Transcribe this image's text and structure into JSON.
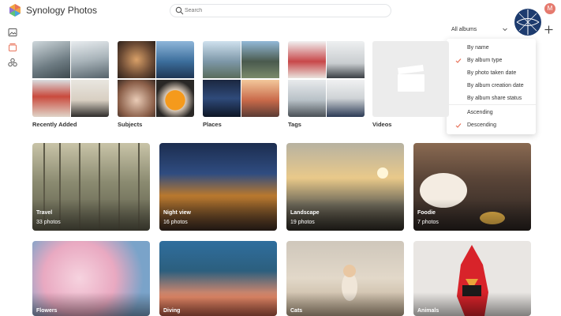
{
  "app": {
    "title": "Synology Photos"
  },
  "search": {
    "placeholder": "Search"
  },
  "user": {
    "initial": "M"
  },
  "sort": {
    "dropdown_label": "All albums",
    "options": [
      {
        "label": "By name",
        "checked": false
      },
      {
        "label": "By album type",
        "checked": true
      },
      {
        "label": "By photo taken date",
        "checked": false
      },
      {
        "label": "By album creation date",
        "checked": false
      },
      {
        "label": "By album share status",
        "checked": false
      },
      {
        "label": "Ascending",
        "checked": false
      },
      {
        "label": "Descending",
        "checked": true
      }
    ]
  },
  "categories": [
    {
      "label": "Recently Added"
    },
    {
      "label": "Subjects"
    },
    {
      "label": "Places"
    },
    {
      "label": "Tags"
    },
    {
      "label": "Videos"
    }
  ],
  "albums": [
    {
      "title": "Travel",
      "count": "33 photos"
    },
    {
      "title": "Night view",
      "count": "16 photos"
    },
    {
      "title": "Landscape",
      "count": "19 photos"
    },
    {
      "title": "Foodie",
      "count": "7 photos"
    },
    {
      "title": "Flowers",
      "count": ""
    },
    {
      "title": "Diving",
      "count": ""
    },
    {
      "title": "Cats",
      "count": ""
    },
    {
      "title": "Animals",
      "count": ""
    }
  ],
  "colors": {
    "accent": "#e8735a",
    "avatar": "#e57a6e"
  }
}
